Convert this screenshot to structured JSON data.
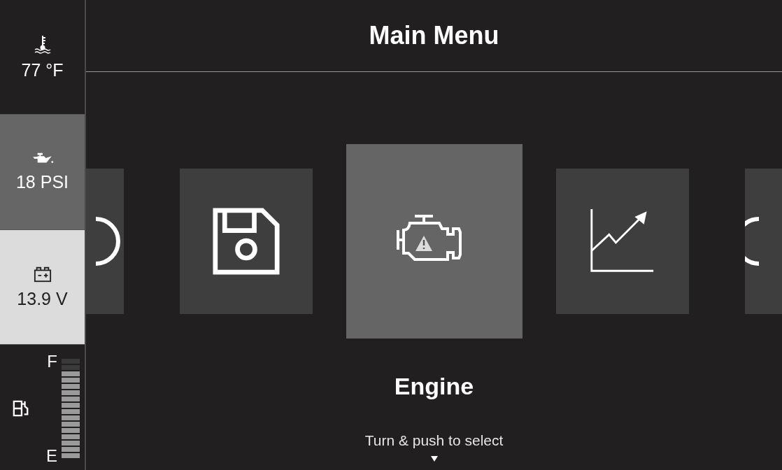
{
  "title": "Main Menu",
  "gauges": [
    {
      "kind": "temperature",
      "reading": "77 °F",
      "color": "#221f20"
    },
    {
      "kind": "oil",
      "reading": "18 PSI",
      "color": "#666666"
    },
    {
      "kind": "battery",
      "reading": "13.9 V",
      "color": "#dcdcdd"
    }
  ],
  "fuel": {
    "full_label": "F",
    "empty_label": "E",
    "level": 0.875
  },
  "menu": {
    "items": [
      {
        "kind": "circle",
        "selected": false
      },
      {
        "kind": "save",
        "selected": false
      },
      {
        "kind": "engine",
        "selected": true
      },
      {
        "kind": "chart",
        "selected": false
      },
      {
        "kind": "circle-left",
        "selected": false
      }
    ],
    "selected_label": "Engine",
    "hint": "Turn & push to select"
  }
}
